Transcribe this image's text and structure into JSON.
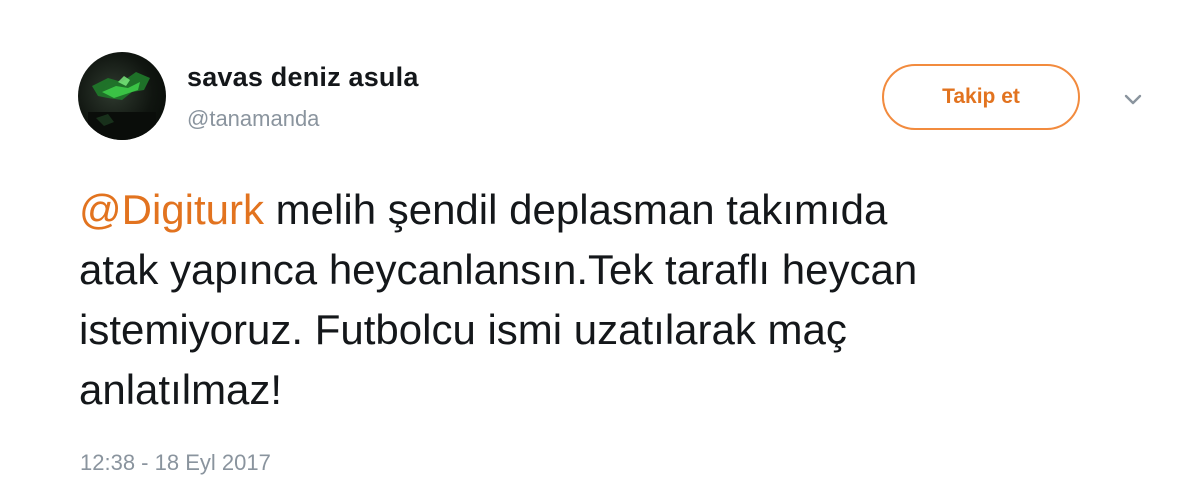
{
  "user": {
    "display_name": "savas deniz asula",
    "handle": "@tanamanda",
    "avatar_icon": "profile-photo"
  },
  "actions": {
    "follow_label": "Takip et",
    "menu_icon": "chevron-down-icon"
  },
  "tweet": {
    "mention": "@Digiturk",
    "line1_rest": " melih şendil deplasman takımıda",
    "line2": "atak yapınca heycanlansın.Tek taraflı heycan",
    "line3": "istemiyoruz. Futbolcu ismi uzatılarak maç",
    "line4": "anlatılmaz!",
    "timestamp": "12:38 - 18 Eyl 2017"
  },
  "colors": {
    "accent": "#e2731f",
    "text": "#14171a",
    "muted": "#8a949e"
  }
}
